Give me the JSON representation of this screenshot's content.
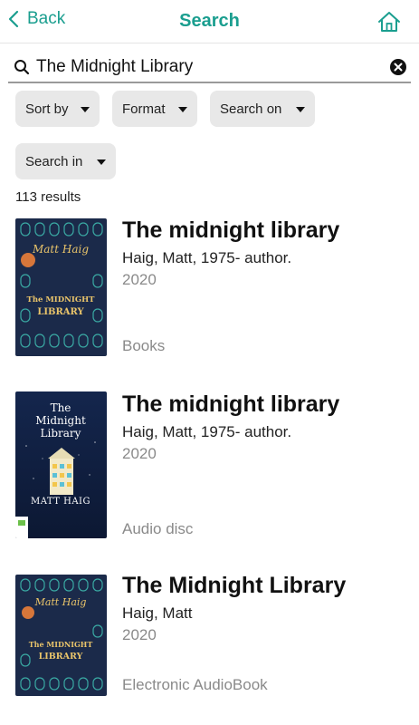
{
  "nav": {
    "back_label": "Back",
    "title": "Search"
  },
  "search": {
    "value": "The Midnight Library"
  },
  "filters": [
    "Sort by",
    "Format",
    "Search on",
    "Search in"
  ],
  "results_count": "113 results",
  "results": [
    {
      "title": "The midnight library",
      "author": "Haig, Matt, 1975- author.",
      "year": "2020",
      "format": "Books",
      "cover": {
        "author": "Matt Haig",
        "line1": "The MIDNIGHT",
        "line2": "LIBRARY"
      }
    },
    {
      "title": "The midnight library",
      "author": "Haig, Matt, 1975- author.",
      "year": "2020",
      "format": "Audio disc",
      "cover": {
        "line1": "The",
        "line2": "Midnight",
        "line3": "Library",
        "author": "MATT HAIG"
      }
    },
    {
      "title": "The Midnight Library",
      "author": "Haig, Matt",
      "year": "2020",
      "format": "Electronic AudioBook",
      "cover": {
        "author": "Matt Haig",
        "line1": "The MIDNIGHT",
        "line2": "LIBRARY"
      }
    }
  ],
  "colors": {
    "accent": "#1a9e8f",
    "chip_bg": "#e8e8e8",
    "muted_text": "#8a8a8a",
    "cover_navy": "#1b2a4a"
  },
  "icons": [
    "chevron-left-icon",
    "home-icon",
    "search-icon",
    "clear-icon",
    "caret-down-icon"
  ]
}
